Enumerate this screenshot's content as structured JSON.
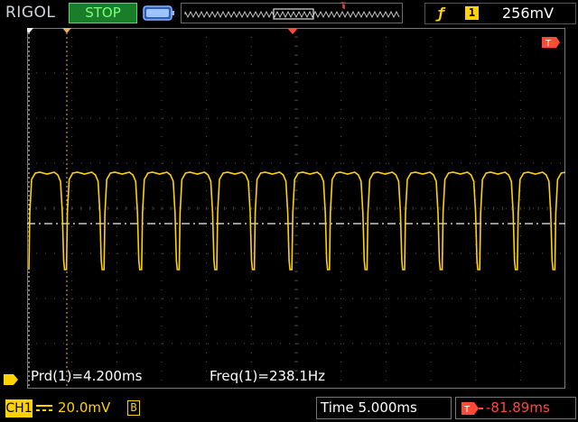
{
  "header": {
    "brand": "RIGOL",
    "run_state": "STOP",
    "trigger_marker": "T",
    "trigger_source": "1",
    "trigger_level": "256mV",
    "trigger_slope_icon": "rising-edge-icon",
    "colors": {
      "ch1": "#ffd200",
      "stop_bg": "#1a7d2a",
      "trigger": "#ff4a3a",
      "grid": "#3c3c3c"
    }
  },
  "screen": {
    "trigger_flag": "T",
    "channel_marker": "1"
  },
  "measurements": {
    "period": "Prd(1)=4.200ms",
    "frequency": "Freq(1)=238.1Hz"
  },
  "footer": {
    "channel": "CH1",
    "volts_per_div": "20.0mV",
    "bandwidth_limit": "B",
    "time_base": "Time 5.000ms",
    "trigger_position": "-81.89ms"
  }
}
